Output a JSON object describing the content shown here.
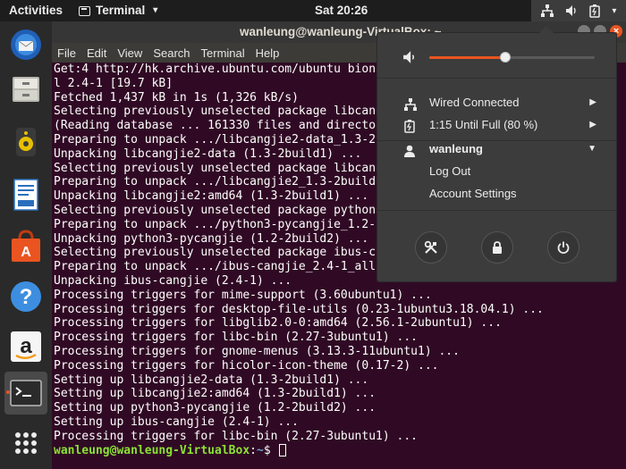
{
  "topbar": {
    "activities": "Activities",
    "app_name": "Terminal",
    "clock": "Sat 20:26"
  },
  "dock": {
    "items": [
      {
        "name": "thunderbird-icon"
      },
      {
        "name": "files-icon"
      },
      {
        "name": "rhythmbox-icon"
      },
      {
        "name": "writer-icon"
      },
      {
        "name": "software-icon"
      },
      {
        "name": "help-icon"
      },
      {
        "name": "amazon-icon"
      },
      {
        "name": "terminal-icon",
        "active": true
      },
      {
        "name": "show-apps-icon"
      }
    ]
  },
  "terminal": {
    "title": "wanleung@wanleung-VirtualBox: ~",
    "menu": [
      "File",
      "Edit",
      "View",
      "Search",
      "Terminal",
      "Help"
    ],
    "lines": [
      "Get:4 http://hk.archive.ubuntu.com/ubuntu bion",
      "l 2.4-1 [19.7 kB]",
      "Fetched 1,437 kB in 1s (1,326 kB/s)",
      "Selecting previously unselected package libcan",
      "(Reading database ... 161330 files and directo",
      "Preparing to unpack .../libcangjie2-data_1.3-2",
      "Unpacking libcangjie2-data (1.3-2build1) ...",
      "Selecting previously unselected package libcan",
      "Preparing to unpack .../libcangjie2_1.3-2build",
      "Unpacking libcangjie2:amd64 (1.3-2build1) ...",
      "Selecting previously unselected package python",
      "Preparing to unpack .../python3-pycangjie_1.2-",
      "Unpacking python3-pycangjie (1.2-2build2) ...",
      "Selecting previously unselected package ibus-c",
      "Preparing to unpack .../ibus-cangjie_2.4-1_all",
      "Unpacking ibus-cangjie (2.4-1) ...",
      "Processing triggers for mime-support (3.60ubuntu1) ...",
      "Processing triggers for desktop-file-utils (0.23-1ubuntu3.18.04.1) ...",
      "Processing triggers for libglib2.0-0:amd64 (2.56.1-2ubuntu1) ...",
      "Processing triggers for libc-bin (2.27-3ubuntu1) ...",
      "Processing triggers for gnome-menus (3.13.3-11ubuntu1) ...",
      "Processing triggers for hicolor-icon-theme (0.17-2) ...",
      "Setting up libcangjie2-data (1.3-2build1) ...",
      "Setting up libcangjie2:amd64 (1.3-2build1) ...",
      "Setting up python3-pycangjie (1.2-2build2) ...",
      "Setting up ibus-cangjie (2.4-1) ...",
      "Processing triggers for libc-bin (2.27-3ubuntu1) ..."
    ],
    "prompt_user": "wanleung@wanleung-VirtualBox",
    "prompt_sep": ":",
    "prompt_path": "~",
    "prompt_symbol": "$ "
  },
  "system_menu": {
    "volume_level": 0.46,
    "network": "Wired Connected",
    "battery": "1:15 Until Full (80 %)",
    "user": "wanleung",
    "log_out": "Log Out",
    "account_settings": "Account Settings"
  },
  "colors": {
    "accent": "#e95420",
    "terminal_bg": "#300a24",
    "prompt_user": "#8ae234",
    "prompt_path": "#729fcf"
  }
}
